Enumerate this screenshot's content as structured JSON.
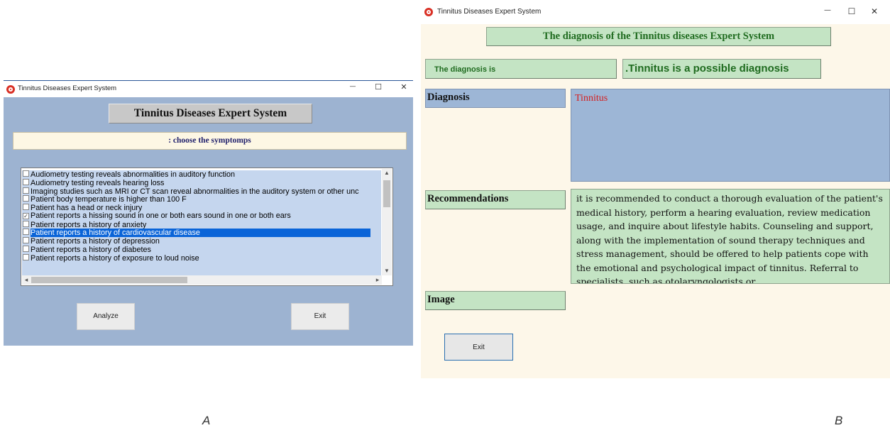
{
  "windowA": {
    "title": "Tinnitus Diseases Expert System",
    "controls": {
      "minimize": "—",
      "maximize": "☐",
      "close": "✕"
    },
    "header": "Tinnitus Diseases Expert System",
    "prompt": ": choose the symptomps",
    "symptoms": [
      {
        "label": "Audiometry testing reveals abnormalities in auditory function",
        "checked": false,
        "selected": false
      },
      {
        "label": "Audiometry testing reveals hearing loss",
        "checked": false,
        "selected": false
      },
      {
        "label": "Imaging studies such as MRI or CT scan reveal abnormalities in the auditory system or other unc",
        "checked": false,
        "selected": false
      },
      {
        "label": "Patient body temperature is higher than 100 F",
        "checked": false,
        "selected": false
      },
      {
        "label": "Patient has a head or neck injury",
        "checked": false,
        "selected": false
      },
      {
        "label": "Patient reports a hissing sound in one or both ears sound in one or both ears",
        "checked": true,
        "selected": false
      },
      {
        "label": "Patient reports a history of anxiety",
        "checked": false,
        "selected": false
      },
      {
        "label": "Patient reports a history of cardiovascular disease",
        "checked": false,
        "selected": true
      },
      {
        "label": "Patient reports a history of depression",
        "checked": false,
        "selected": false
      },
      {
        "label": "Patient reports a history of diabetes",
        "checked": false,
        "selected": false
      },
      {
        "label": "Patient reports a history of exposure to loud noise",
        "checked": false,
        "selected": false
      }
    ],
    "buttons": {
      "analyze": "Analyze",
      "exit": "Exit"
    }
  },
  "windowB": {
    "title": "Tinnitus Diseases Expert System",
    "controls": {
      "minimize": "—",
      "maximize": "☐",
      "close": "✕"
    },
    "header": "The diagnosis of the Tinnitus diseases Expert System",
    "diagnosis_is_label": "The diagnosis is",
    "diagnosis_value": ".Tinnitus is a possible diagnosis",
    "diagnosis_label": "Diagnosis",
    "diagnosis_text": "Tinnitus",
    "recommendations_label": "Recommendations",
    "recommendations_text": "it is recommended to conduct a thorough evaluation of the patient's medical history, perform a hearing evaluation, review medication usage, and inquire about lifestyle habits. Counseling and support, along with the implementation of sound therapy techniques and stress management, should be offered to help patients cope with the emotional and psychological impact of tinnitus. Referral to specialists, such as otolaryngologists or",
    "image_label": "Image",
    "exit_button": "Exit"
  },
  "captions": {
    "a": "A",
    "b": "B"
  },
  "colors": {
    "accent_red": "#d93025",
    "green_text": "#1f6b1f",
    "selection_blue": "#0a64d8"
  }
}
